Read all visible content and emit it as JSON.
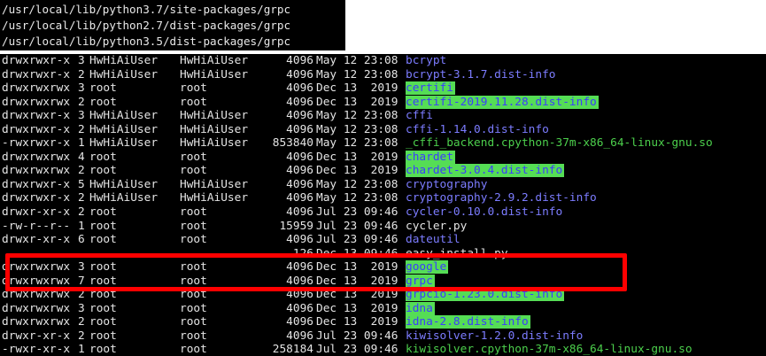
{
  "paths": [
    "/usr/local/lib/python3.7/site-packages/grpc",
    "/usr/local/lib/python2.7/dist-packages/grpc",
    "/usr/local/lib/python3.5/dist-packages/grpc"
  ],
  "listing": [
    {
      "perm": "drwxrwxr-x",
      "links": "3",
      "owner": "HwHiAiUser",
      "group": "HwHiAiUser",
      "size": "4096",
      "date": "May 12 23:08",
      "name": "bcrypt",
      "kind": "dir"
    },
    {
      "perm": "drwxrwxr-x",
      "links": "2",
      "owner": "HwHiAiUser",
      "group": "HwHiAiUser",
      "size": "4096",
      "date": "May 12 23:08",
      "name": "bcrypt-3.1.7.dist-info",
      "kind": "dir"
    },
    {
      "perm": "drwxrwxrwx",
      "links": "3",
      "owner": "root",
      "group": "root",
      "size": "4096",
      "date": "Dec 13  2019",
      "name": "certifi",
      "kind": "hl"
    },
    {
      "perm": "drwxrwxrwx",
      "links": "2",
      "owner": "root",
      "group": "root",
      "size": "4096",
      "date": "Dec 13  2019",
      "name": "certifi-2019.11.28.dist-info",
      "kind": "hl"
    },
    {
      "perm": "drwxrwxr-x",
      "links": "3",
      "owner": "HwHiAiUser",
      "group": "HwHiAiUser",
      "size": "4096",
      "date": "May 12 23:08",
      "name": "cffi",
      "kind": "dir"
    },
    {
      "perm": "drwxrwxr-x",
      "links": "2",
      "owner": "HwHiAiUser",
      "group": "HwHiAiUser",
      "size": "4096",
      "date": "May 12 23:08",
      "name": "cffi-1.14.0.dist-info",
      "kind": "dir"
    },
    {
      "perm": "-rwxrwxr-x",
      "links": "1",
      "owner": "HwHiAiUser",
      "group": "HwHiAiUser",
      "size": "853840",
      "date": "May 12 23:08",
      "name": "_cffi_backend.cpython-37m-x86_64-linux-gnu.so",
      "kind": "exe"
    },
    {
      "perm": "drwxrwxrwx",
      "links": "4",
      "owner": "root",
      "group": "root",
      "size": "4096",
      "date": "Dec 13  2019",
      "name": "chardet",
      "kind": "hl"
    },
    {
      "perm": "drwxrwxrwx",
      "links": "2",
      "owner": "root",
      "group": "root",
      "size": "4096",
      "date": "Dec 13  2019",
      "name": "chardet-3.0.4.dist-info",
      "kind": "hl"
    },
    {
      "perm": "drwxrwxr-x",
      "links": "5",
      "owner": "HwHiAiUser",
      "group": "HwHiAiUser",
      "size": "4096",
      "date": "May 12 23:08",
      "name": "cryptography",
      "kind": "dir"
    },
    {
      "perm": "drwxrwxr-x",
      "links": "2",
      "owner": "HwHiAiUser",
      "group": "HwHiAiUser",
      "size": "4096",
      "date": "May 12 23:08",
      "name": "cryptography-2.9.2.dist-info",
      "kind": "dir"
    },
    {
      "perm": "drwxr-xr-x",
      "links": "2",
      "owner": "root",
      "group": "root",
      "size": "4096",
      "date": "Jul 23 09:46",
      "name": "cycler-0.10.0.dist-info",
      "kind": "dir"
    },
    {
      "perm": "-rw-r--r--",
      "links": "1",
      "owner": "root",
      "group": "root",
      "size": "15959",
      "date": "Jul 23 09:46",
      "name": "cycler.py",
      "kind": "file"
    },
    {
      "perm": "drwxr-xr-x",
      "links": "6",
      "owner": "root",
      "group": "root",
      "size": "4096",
      "date": "Jul 23 09:46",
      "name": "dateutil",
      "kind": "dir"
    },
    {
      "perm": "",
      "links": "",
      "owner": "",
      "group": "",
      "size": "126",
      "date": "Dec 13 09:46",
      "name": "easy_install.py",
      "kind": "file"
    },
    {
      "perm": "drwxrwxrwx",
      "links": "3",
      "owner": "root",
      "group": "root",
      "size": "4096",
      "date": "Dec 13  2019",
      "name": "google",
      "kind": "hl"
    },
    {
      "perm": "drwxrwxrwx",
      "links": "7",
      "owner": "root",
      "group": "root",
      "size": "4096",
      "date": "Dec 13  2019",
      "name": "grpc",
      "kind": "hl"
    },
    {
      "perm": "drwxrwxrwx",
      "links": "2",
      "owner": "root",
      "group": "root",
      "size": "4096",
      "date": "Dec 13  2019",
      "name": "grpcio-1.23.0.dist-info",
      "kind": "hl"
    },
    {
      "perm": "drwxrwxrwx",
      "links": "3",
      "owner": "root",
      "group": "root",
      "size": "4096",
      "date": "Dec 13  2019",
      "name": "idna",
      "kind": "hl"
    },
    {
      "perm": "drwxrwxrwx",
      "links": "2",
      "owner": "root",
      "group": "root",
      "size": "4096",
      "date": "Dec 13  2019",
      "name": "idna-2.8.dist-info",
      "kind": "hl"
    },
    {
      "perm": "drwxr-xr-x",
      "links": "2",
      "owner": "root",
      "group": "root",
      "size": "4096",
      "date": "Jul 23 09:46",
      "name": "kiwisolver-1.2.0.dist-info",
      "kind": "dir"
    },
    {
      "perm": "-rwxr-xr-x",
      "links": "1",
      "owner": "root",
      "group": "root",
      "size": "258184",
      "date": "Jul 23 09:46",
      "name": "kiwisolver.cpython-37m-x86_64-linux-gnu.so",
      "kind": "exe"
    }
  ],
  "colors": {
    "highlight_box": "#ff0000",
    "dir": "#7c7cff",
    "exe": "#4ccf4c",
    "hl_bg": "#55dd55"
  }
}
